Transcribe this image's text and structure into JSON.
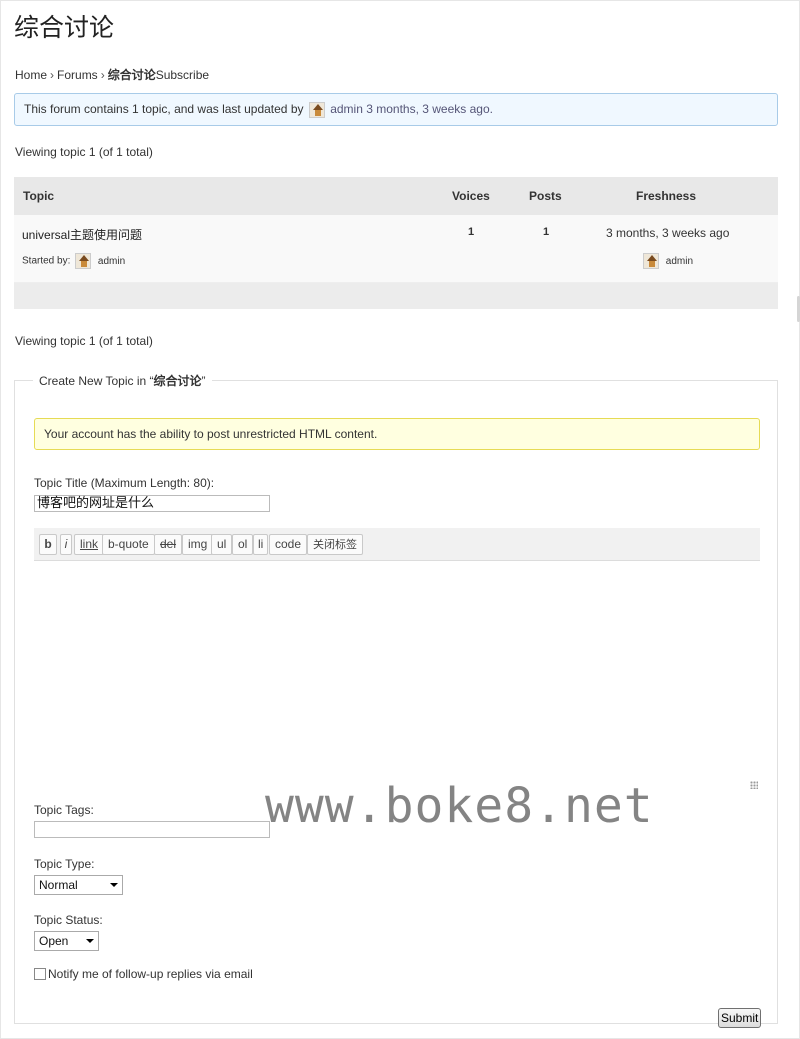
{
  "forum": {
    "title": "综合讨论"
  },
  "breadcrumb": {
    "home": "Home",
    "separator": "›",
    "forums": "Forums",
    "current": "综合讨论",
    "subscribe": "Subscribe"
  },
  "info": {
    "prefix": "This forum contains 1 topic, and was last updated by",
    "user": "admin",
    "when": "3 months, 3 weeks ago."
  },
  "pagination": {
    "viewing_top": "Viewing topic 1 (of 1 total)",
    "viewing_bottom": "Viewing topic 1 (of 1 total)"
  },
  "table": {
    "headers": {
      "topic": "Topic",
      "voices": "Voices",
      "posts": "Posts",
      "freshness": "Freshness"
    },
    "rows": [
      {
        "title": "universal主题使用问题",
        "started_by_label": "Started by:",
        "author": "admin",
        "voices": "1",
        "posts": "1",
        "freshness": "3 months, 3 weeks ago",
        "last_user": "admin"
      }
    ]
  },
  "new_topic": {
    "legend_prefix": "Create New Topic in “",
    "legend_forum": "综合讨论",
    "legend_suffix": "”",
    "notice": "Your account has the ability to post unrestricted HTML content.",
    "title_label": "Topic Title (Maximum Length: 80):",
    "title_value": "博客吧的网址是什么",
    "toolbar": [
      "b",
      "i",
      "link",
      "b-quote",
      "del",
      "img",
      "ul",
      "ol",
      "li",
      "code",
      "关闭标签"
    ],
    "content_value": "",
    "tags_label": "Topic Tags:",
    "tags_value": "",
    "type_label": "Topic Type:",
    "type_value": "Normal",
    "status_label": "Topic Status:",
    "status_value": "Open",
    "notify_label": "Notify me of follow-up replies via email",
    "notify_checked": false,
    "submit_label": "Submit"
  },
  "watermark": "www.boke8.net"
}
